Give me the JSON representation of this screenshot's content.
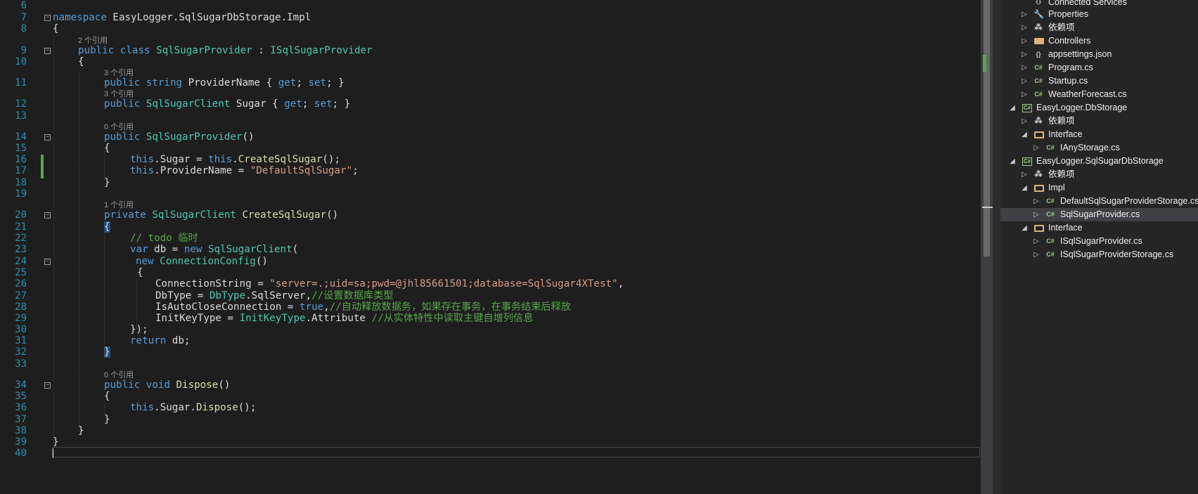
{
  "editor": {
    "codelens": {
      "refs2": "2 个引用",
      "refs3a": "3 个引用",
      "refs3b": "3 个引用",
      "refs0a": "0 个引用",
      "refs1": "1 个引用",
      "refs0b": "0 个引用"
    },
    "line_numbers": [
      "6",
      "7",
      "8",
      "9",
      "10",
      "11",
      "12",
      "13",
      "14",
      "15",
      "16",
      "17",
      "18",
      "19",
      "20",
      "21",
      "22",
      "23",
      "24",
      "25",
      "26",
      "27",
      "28",
      "29",
      "30",
      "31",
      "32",
      "33",
      "34",
      "35",
      "36",
      "37",
      "38",
      "39",
      "40"
    ],
    "code": {
      "l7_kw": "namespace",
      "l7_rest": " EasyLogger.SqlSugarDbStorage.Impl",
      "l8": "{",
      "l9_public": "public",
      "l9_class": "class",
      "l9_name": "SqlSugarProvider",
      "l9_colon": " : ",
      "l9_iface": "ISqlSugarProvider",
      "l10": "{",
      "l11_public": "public",
      "l11_string": "string",
      "l11_name": " ProviderName { ",
      "l11_get": "get",
      "l11_semi1": "; ",
      "l11_set": "set",
      "l11_end": "; }",
      "l12_public": "public",
      "l12_type": "SqlSugarClient",
      "l12_name": " Sugar { ",
      "l12_get": "get",
      "l12_semi1": "; ",
      "l12_set": "set",
      "l12_end": "; }",
      "l14_public": "public",
      "l14_ctor": "SqlSugarProvider",
      "l14_paren": "()",
      "l15": "{",
      "l16_this1": "this",
      "l16_mid": ".Sugar = ",
      "l16_this2": "this",
      "l16_dot": ".",
      "l16_method": "CreateSqlSugar",
      "l16_end": "();",
      "l17_this": "this",
      "l17_mid": ".ProviderName = ",
      "l17_str": "\"DefaultSqlSugar\"",
      "l17_end": ";",
      "l18": "}",
      "l20_private": "private",
      "l20_type": "SqlSugarClient",
      "l20_method": "CreateSqlSugar",
      "l20_paren": "()",
      "l21": "{",
      "l22_comment": "// todo 临时",
      "l23_var": "var",
      "l23_mid": " db = ",
      "l23_new": "new",
      "l23_type": "SqlSugarClient",
      "l23_paren": "(",
      "l24_new": "new",
      "l24_type": "ConnectionConfig",
      "l24_paren": "()",
      "l25": "{",
      "l26_prop": "ConnectionString = ",
      "l26_str": "\"server=.;uid=sa;pwd=@jhl85661501;database=SqlSugar4XTest\"",
      "l26_end": ",",
      "l27_prop": "DbType = ",
      "l27_type": "DbType",
      "l27_val": ".SqlServer,",
      "l27_comment": "//设置数据库类型",
      "l28_prop": "IsAutoCloseConnection = ",
      "l28_true": "true",
      "l28_comma": ",",
      "l28_comment": "//自动释放数据务，如果存在事务，在事务结束后释放",
      "l29_prop": "InitKeyType = ",
      "l29_type": "InitKeyType",
      "l29_val": ".Attribute ",
      "l29_comment": "//从实体特性中读取主键自增列信息",
      "l30": "});",
      "l31_return": "return",
      "l31_rest": " db;",
      "l32": "}",
      "l34_public": "public",
      "l34_void": "void",
      "l34_method": "Dispose",
      "l34_paren": "()",
      "l35": "{",
      "l36_this": "this",
      "l36_mid": ".Sugar.",
      "l36_method": "Dispose",
      "l36_end": "();",
      "l37": "}",
      "l38": "}",
      "l39": "}"
    }
  },
  "solution_explorer": {
    "items": [
      {
        "label": "Connected Services",
        "icon": "connected-services-icon"
      },
      {
        "label": "Properties",
        "icon": "wrench-icon"
      },
      {
        "label": "依赖项",
        "icon": "dependencies-icon"
      },
      {
        "label": "Controllers",
        "icon": "folder-icon"
      },
      {
        "label": "appsettings.json",
        "icon": "json-file-icon"
      },
      {
        "label": "Program.cs",
        "icon": "csharp-file-icon"
      },
      {
        "label": "Startup.cs",
        "icon": "csharp-file-icon"
      },
      {
        "label": "WeatherForecast.cs",
        "icon": "csharp-file-icon"
      },
      {
        "label": "EasyLogger.DbStorage",
        "icon": "csharp-project-icon"
      },
      {
        "label": "依赖项",
        "icon": "dependencies-icon"
      },
      {
        "label": "Interface",
        "icon": "folder-open-icon"
      },
      {
        "label": "IAnyStorage.cs",
        "icon": "csharp-file-icon"
      },
      {
        "label": "EasyLogger.SqlSugarDbStorage",
        "icon": "csharp-project-icon"
      },
      {
        "label": "依赖项",
        "icon": "dependencies-icon"
      },
      {
        "label": "Impl",
        "icon": "folder-open-icon"
      },
      {
        "label": "DefaultSqlSugarProviderStorage.cs",
        "icon": "csharp-file-icon"
      },
      {
        "label": "SqlSugarProvider.cs",
        "icon": "csharp-file-icon",
        "selected": true
      },
      {
        "label": "Interface",
        "icon": "folder-open-icon"
      },
      {
        "label": "ISqlSugarProvider.cs",
        "icon": "csharp-file-icon"
      },
      {
        "label": "ISqlSugarProviderStorage.cs",
        "icon": "csharp-file-icon"
      }
    ],
    "csharp_glyph": "C#",
    "expanded_arrow": "◢",
    "collapsed_arrow": "▷"
  },
  "colors": {
    "keyword": "#569cd6",
    "type": "#4ec9b0",
    "string": "#d69d85",
    "comment": "#57a64a",
    "method": "#dcdcaa",
    "line_number": "#2b91af",
    "selection": "#3f3f46"
  }
}
